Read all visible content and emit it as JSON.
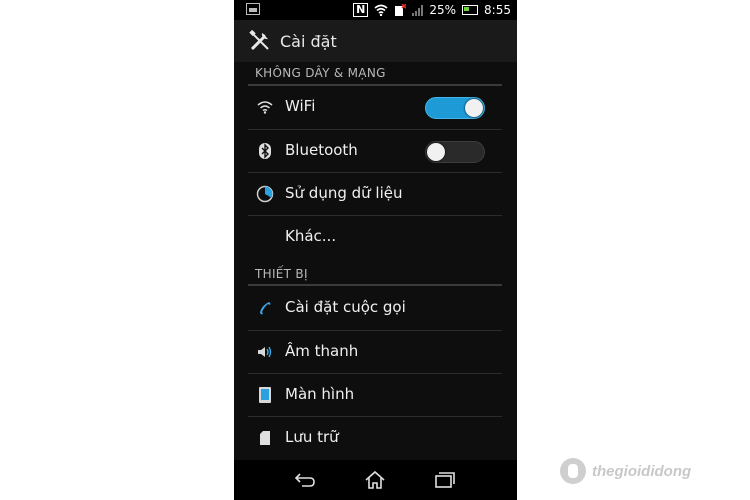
{
  "status_bar": {
    "battery_percent": "25%",
    "time": "8:55",
    "nfc_icon": "N"
  },
  "action_bar": {
    "title": "Cài đặt",
    "icon": "wrench-screwdriver-icon"
  },
  "sections": [
    {
      "header": "KHÔNG DÂY & MẠNG",
      "items": [
        {
          "label": "WiFi",
          "icon": "wifi-icon",
          "toggle": "on"
        },
        {
          "label": "Bluetooth",
          "icon": "bluetooth-icon",
          "toggle": "off"
        },
        {
          "label": "Sử dụng dữ liệu",
          "icon": "data-usage-icon"
        },
        {
          "label": "Khác...",
          "icon": ""
        }
      ]
    },
    {
      "header": "THIẾT BỊ",
      "items": [
        {
          "label": "Cài đặt cuộc gọi",
          "icon": "phone-icon"
        },
        {
          "label": "Âm thanh",
          "icon": "speaker-icon"
        },
        {
          "label": "Màn hình",
          "icon": "display-icon"
        },
        {
          "label": "Lưu trữ",
          "icon": "storage-icon"
        }
      ]
    }
  ],
  "nav_bar": {
    "buttons": [
      "back-icon",
      "home-icon",
      "recent-apps-icon"
    ]
  },
  "watermark": {
    "text": "thegioididong"
  },
  "colors": {
    "accent": "#1e9ad6",
    "background": "#0e0e0e",
    "text": "#f0f0f0",
    "section_header": "#b9b9b9"
  }
}
